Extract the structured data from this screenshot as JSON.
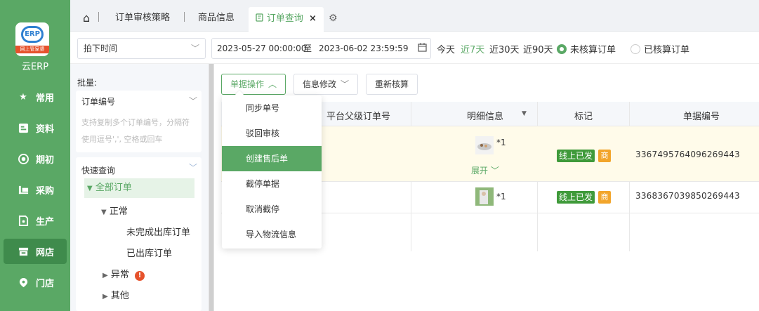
{
  "brand": {
    "logo_text": "ERP",
    "logo_ribbon": "网上管家婆",
    "name": "云ERP"
  },
  "nav": [
    {
      "label": "常用",
      "icon": "star-icon"
    },
    {
      "label": "资料",
      "icon": "profile-icon"
    },
    {
      "label": "期初",
      "icon": "target-icon"
    },
    {
      "label": "采购",
      "icon": "purchase-icon"
    },
    {
      "label": "生产",
      "icon": "production-icon"
    },
    {
      "label": "网店",
      "icon": "store-icon",
      "active": true
    },
    {
      "label": "门店",
      "icon": "shop-pin-icon"
    }
  ],
  "tabs": {
    "home_icon": "⌂",
    "items": [
      {
        "label": "订单审核策略"
      },
      {
        "label": "商品信息"
      },
      {
        "label": "订单查询",
        "active": true,
        "close": "×"
      }
    ],
    "settings_icon": "⚙"
  },
  "filter": {
    "time_select": "拍下时间",
    "date_start": "2023-05-27 00:00:00",
    "date_sep": "至",
    "date_end": "2023-06-02 23:59:59",
    "quick": [
      "今天",
      "近7天",
      "近30天",
      "近90天"
    ],
    "quick_active": "近7天",
    "radio_unsettled": "未核算订单",
    "radio_settled": "已核算订单"
  },
  "side": {
    "batch_label": "批量:",
    "order_no_header": "订单编号",
    "order_no_placeholder": "支持复制多个订单编号，分隔符使用逗号',', 空格或回车",
    "quick_query": "快速查询",
    "tree": {
      "all": "全部订单",
      "normal": "正常",
      "unfinished": "未完成出库订单",
      "shipped": "已出库订单",
      "abnormal": "异常",
      "other": "其他"
    }
  },
  "toolbar": {
    "bill_ops": "单据操作",
    "info_edit": "信息修改",
    "recalc": "重新核算"
  },
  "menu": [
    "同步单号",
    "驳回审核",
    "创建售后单",
    "截停单据",
    "取消截停",
    "导入物流信息"
  ],
  "menu_highlight": 2,
  "table": {
    "headers": {
      "parent_order": "平台父级订单号",
      "detail": "明细信息",
      "mark": "标记",
      "bill_no": "单据编号"
    },
    "rows": [
      {
        "qty": "*1",
        "expand": "展开",
        "tag": "线上已发",
        "tag2": "商",
        "bill_no": "3367495764096269443"
      },
      {
        "qty": "*1",
        "tag": "线上已发",
        "tag2": "商",
        "bill_no": "3368367039850269443"
      }
    ]
  }
}
